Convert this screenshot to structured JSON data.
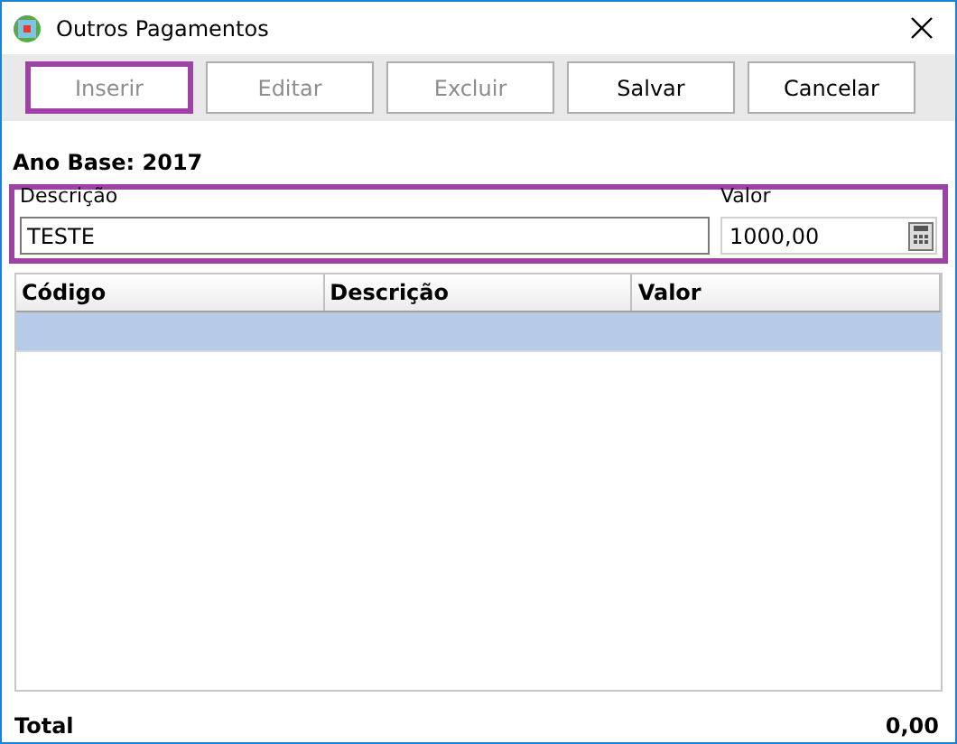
{
  "window": {
    "title": "Outros Pagamentos"
  },
  "toolbar": [
    {
      "label": "Inserir",
      "disabled": true,
      "highlighted": true
    },
    {
      "label": "Editar",
      "disabled": true,
      "highlighted": false
    },
    {
      "label": "Excluir",
      "disabled": true,
      "highlighted": false
    },
    {
      "label": "Salvar",
      "disabled": false,
      "highlighted": false
    },
    {
      "label": "Cancelar",
      "disabled": false,
      "highlighted": false
    }
  ],
  "ano_base": "Ano Base: 2017",
  "form": {
    "highlighted": true,
    "descricao": {
      "label": "Descrição",
      "value": "TESTE"
    },
    "valor": {
      "label": "Valor",
      "value": "1000,00"
    }
  },
  "table": {
    "columns": [
      "Código",
      "Descrição",
      "Valor"
    ],
    "rows": [
      {
        "selected": true,
        "cells": [
          "",
          "",
          ""
        ]
      }
    ]
  },
  "total": {
    "label": "Total",
    "value": "0,00"
  }
}
